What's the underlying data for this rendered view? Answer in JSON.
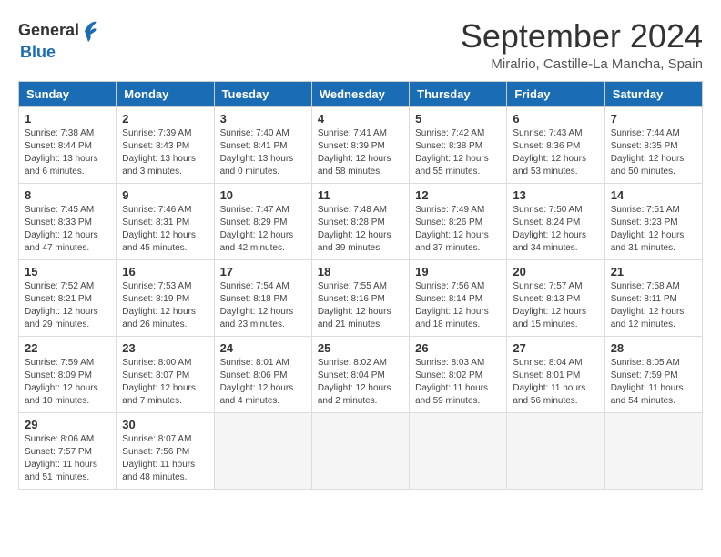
{
  "header": {
    "logo_general": "General",
    "logo_blue": "Blue",
    "month_title": "September 2024",
    "location": "Miralrio, Castille-La Mancha, Spain"
  },
  "days_of_week": [
    "Sunday",
    "Monday",
    "Tuesday",
    "Wednesday",
    "Thursday",
    "Friday",
    "Saturday"
  ],
  "weeks": [
    [
      {
        "day": "1",
        "info": "Sunrise: 7:38 AM\nSunset: 8:44 PM\nDaylight: 13 hours\nand 6 minutes."
      },
      {
        "day": "2",
        "info": "Sunrise: 7:39 AM\nSunset: 8:43 PM\nDaylight: 13 hours\nand 3 minutes."
      },
      {
        "day": "3",
        "info": "Sunrise: 7:40 AM\nSunset: 8:41 PM\nDaylight: 13 hours\nand 0 minutes."
      },
      {
        "day": "4",
        "info": "Sunrise: 7:41 AM\nSunset: 8:39 PM\nDaylight: 12 hours\nand 58 minutes."
      },
      {
        "day": "5",
        "info": "Sunrise: 7:42 AM\nSunset: 8:38 PM\nDaylight: 12 hours\nand 55 minutes."
      },
      {
        "day": "6",
        "info": "Sunrise: 7:43 AM\nSunset: 8:36 PM\nDaylight: 12 hours\nand 53 minutes."
      },
      {
        "day": "7",
        "info": "Sunrise: 7:44 AM\nSunset: 8:35 PM\nDaylight: 12 hours\nand 50 minutes."
      }
    ],
    [
      {
        "day": "8",
        "info": "Sunrise: 7:45 AM\nSunset: 8:33 PM\nDaylight: 12 hours\nand 47 minutes."
      },
      {
        "day": "9",
        "info": "Sunrise: 7:46 AM\nSunset: 8:31 PM\nDaylight: 12 hours\nand 45 minutes."
      },
      {
        "day": "10",
        "info": "Sunrise: 7:47 AM\nSunset: 8:29 PM\nDaylight: 12 hours\nand 42 minutes."
      },
      {
        "day": "11",
        "info": "Sunrise: 7:48 AM\nSunset: 8:28 PM\nDaylight: 12 hours\nand 39 minutes."
      },
      {
        "day": "12",
        "info": "Sunrise: 7:49 AM\nSunset: 8:26 PM\nDaylight: 12 hours\nand 37 minutes."
      },
      {
        "day": "13",
        "info": "Sunrise: 7:50 AM\nSunset: 8:24 PM\nDaylight: 12 hours\nand 34 minutes."
      },
      {
        "day": "14",
        "info": "Sunrise: 7:51 AM\nSunset: 8:23 PM\nDaylight: 12 hours\nand 31 minutes."
      }
    ],
    [
      {
        "day": "15",
        "info": "Sunrise: 7:52 AM\nSunset: 8:21 PM\nDaylight: 12 hours\nand 29 minutes."
      },
      {
        "day": "16",
        "info": "Sunrise: 7:53 AM\nSunset: 8:19 PM\nDaylight: 12 hours\nand 26 minutes."
      },
      {
        "day": "17",
        "info": "Sunrise: 7:54 AM\nSunset: 8:18 PM\nDaylight: 12 hours\nand 23 minutes."
      },
      {
        "day": "18",
        "info": "Sunrise: 7:55 AM\nSunset: 8:16 PM\nDaylight: 12 hours\nand 21 minutes."
      },
      {
        "day": "19",
        "info": "Sunrise: 7:56 AM\nSunset: 8:14 PM\nDaylight: 12 hours\nand 18 minutes."
      },
      {
        "day": "20",
        "info": "Sunrise: 7:57 AM\nSunset: 8:13 PM\nDaylight: 12 hours\nand 15 minutes."
      },
      {
        "day": "21",
        "info": "Sunrise: 7:58 AM\nSunset: 8:11 PM\nDaylight: 12 hours\nand 12 minutes."
      }
    ],
    [
      {
        "day": "22",
        "info": "Sunrise: 7:59 AM\nSunset: 8:09 PM\nDaylight: 12 hours\nand 10 minutes."
      },
      {
        "day": "23",
        "info": "Sunrise: 8:00 AM\nSunset: 8:07 PM\nDaylight: 12 hours\nand 7 minutes."
      },
      {
        "day": "24",
        "info": "Sunrise: 8:01 AM\nSunset: 8:06 PM\nDaylight: 12 hours\nand 4 minutes."
      },
      {
        "day": "25",
        "info": "Sunrise: 8:02 AM\nSunset: 8:04 PM\nDaylight: 12 hours\nand 2 minutes."
      },
      {
        "day": "26",
        "info": "Sunrise: 8:03 AM\nSunset: 8:02 PM\nDaylight: 11 hours\nand 59 minutes."
      },
      {
        "day": "27",
        "info": "Sunrise: 8:04 AM\nSunset: 8:01 PM\nDaylight: 11 hours\nand 56 minutes."
      },
      {
        "day": "28",
        "info": "Sunrise: 8:05 AM\nSunset: 7:59 PM\nDaylight: 11 hours\nand 54 minutes."
      }
    ],
    [
      {
        "day": "29",
        "info": "Sunrise: 8:06 AM\nSunset: 7:57 PM\nDaylight: 11 hours\nand 51 minutes."
      },
      {
        "day": "30",
        "info": "Sunrise: 8:07 AM\nSunset: 7:56 PM\nDaylight: 11 hours\nand 48 minutes."
      },
      {
        "day": "",
        "info": ""
      },
      {
        "day": "",
        "info": ""
      },
      {
        "day": "",
        "info": ""
      },
      {
        "day": "",
        "info": ""
      },
      {
        "day": "",
        "info": ""
      }
    ]
  ]
}
